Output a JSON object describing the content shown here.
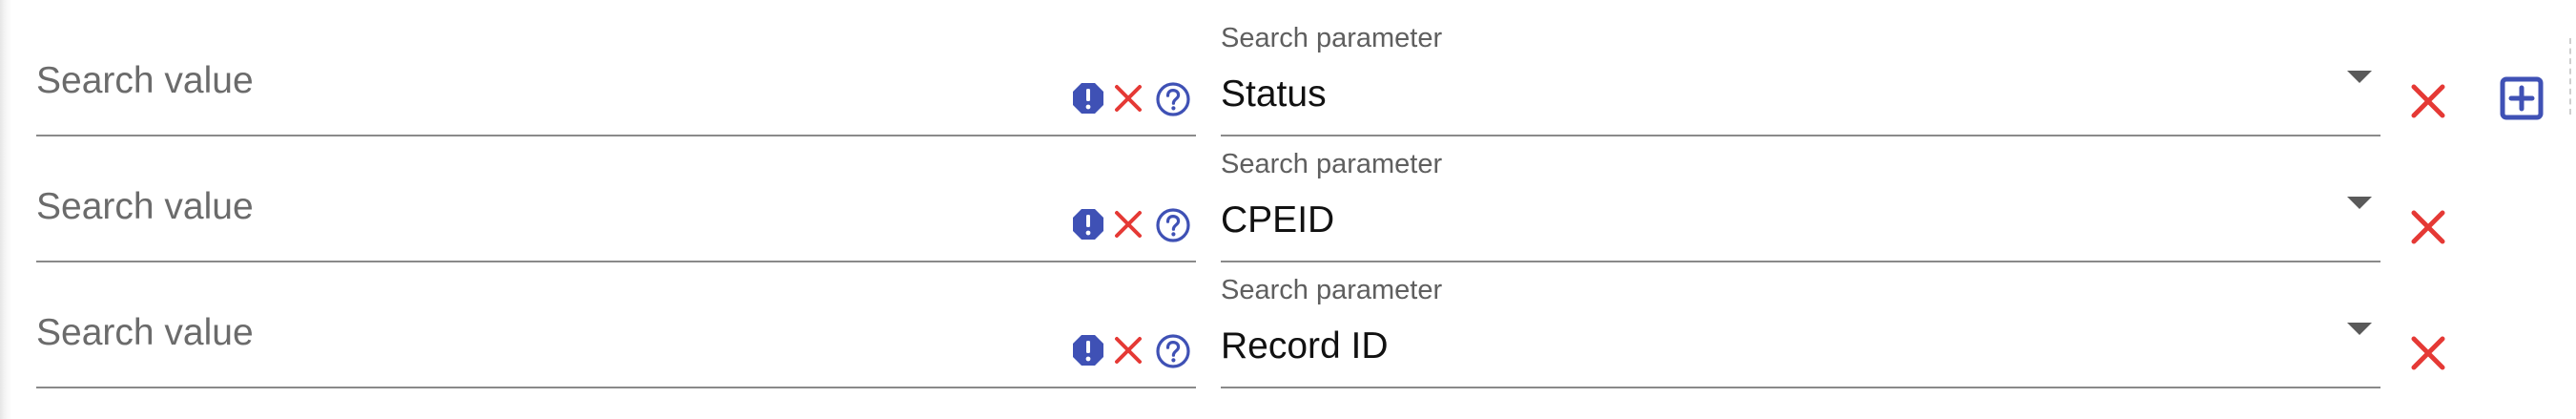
{
  "rows": [
    {
      "value": "",
      "value_placeholder": "Search value",
      "param_label": "Search parameter",
      "param_value": "Status"
    },
    {
      "value": "",
      "value_placeholder": "Search value",
      "param_label": "Search parameter",
      "param_value": "CPEID"
    },
    {
      "value": "",
      "value_placeholder": "Search value",
      "param_label": "Search parameter",
      "param_value": "Record ID"
    }
  ],
  "icons": {
    "validation": "exclamation-icon",
    "clear": "close-icon",
    "help": "help-icon",
    "remove": "close-icon",
    "add": "add-box-icon",
    "dropdown": "arrow-drop-down-icon"
  },
  "colors": {
    "accent_blue": "#3f51b5",
    "delete_red": "#e53935",
    "label_gray": "#5f5f5f",
    "underline_gray": "#8a8a8a"
  }
}
